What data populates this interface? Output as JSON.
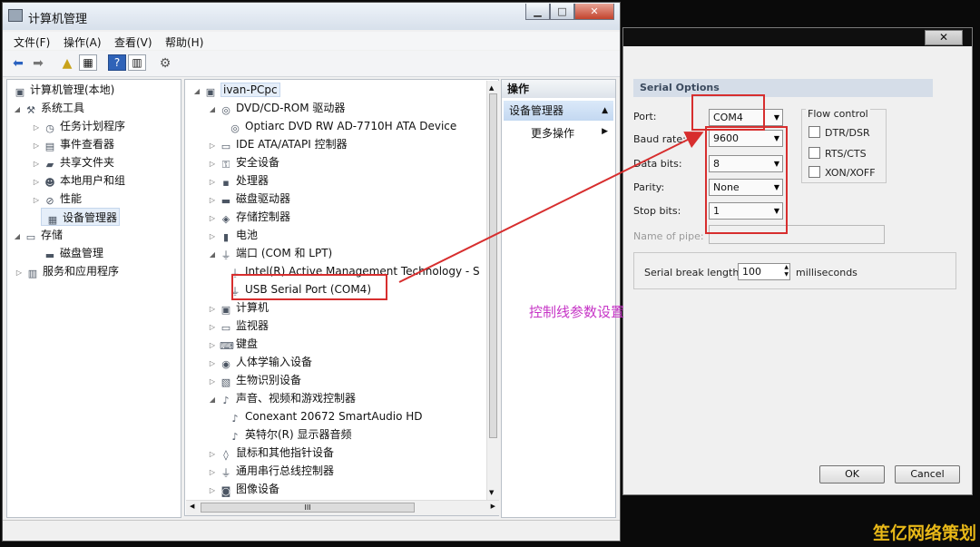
{
  "main_window": {
    "title": "计算机管理",
    "caption_buttons": {
      "minimize": "▁",
      "maximize": "□",
      "close": "✕"
    },
    "menu": [
      "文件(F)",
      "操作(A)",
      "查看(V)",
      "帮助(H)"
    ],
    "left_tree": [
      {
        "label": "计算机管理(本地)",
        "icon": "computer-manage-icon",
        "glyph": "▣"
      },
      {
        "label": "系统工具",
        "icon": "tools-icon",
        "glyph": "⚒"
      },
      {
        "label": "任务计划程序",
        "icon": "clock-icon",
        "glyph": "◷"
      },
      {
        "label": "事件查看器",
        "icon": "event-icon",
        "glyph": "▤"
      },
      {
        "label": "共享文件夹",
        "icon": "folder-icon",
        "glyph": "▰"
      },
      {
        "label": "本地用户和组",
        "icon": "users-icon",
        "glyph": "☻"
      },
      {
        "label": "性能",
        "icon": "performance-icon",
        "glyph": "⊘"
      },
      {
        "label": "设备管理器",
        "icon": "device-manager-icon",
        "glyph": "▦"
      },
      {
        "label": "存储",
        "icon": "storage-icon",
        "glyph": "▭"
      },
      {
        "label": "磁盘管理",
        "icon": "disk-icon",
        "glyph": "▬"
      },
      {
        "label": "服务和应用程序",
        "icon": "services-icon",
        "glyph": "▥"
      }
    ],
    "device_tree": [
      {
        "label": "ivan-PCpc",
        "icon": "computer-icon",
        "glyph": "▣"
      },
      {
        "label": "DVD/CD-ROM 驱动器",
        "icon": "dvd-icon",
        "glyph": "◎"
      },
      {
        "label": "Optiarc DVD RW AD-7710H ATA Device",
        "icon": "dvd-drive-icon",
        "glyph": "◎"
      },
      {
        "label": "IDE ATA/ATAPI 控制器",
        "icon": "ide-icon",
        "glyph": "▭"
      },
      {
        "label": "安全设备",
        "icon": "security-icon",
        "glyph": "⚿"
      },
      {
        "label": "处理器",
        "icon": "processor-icon",
        "glyph": "▪"
      },
      {
        "label": "磁盘驱动器",
        "icon": "disk-drive-icon",
        "glyph": "▬"
      },
      {
        "label": "存储控制器",
        "icon": "storage-controller-icon",
        "glyph": "◈"
      },
      {
        "label": "电池",
        "icon": "battery-icon",
        "glyph": "▮"
      },
      {
        "label": "端口 (COM 和 LPT)",
        "icon": "port-icon",
        "glyph": "⏚"
      },
      {
        "label": "Intel(R) Active Management Technology - S",
        "icon": "port-device-icon",
        "glyph": "⏚"
      },
      {
        "label": "USB Serial Port (COM4)",
        "icon": "usb-serial-icon",
        "glyph": "⏚"
      },
      {
        "label": "计算机",
        "icon": "pc-icon",
        "glyph": "▣"
      },
      {
        "label": "监视器",
        "icon": "monitor-icon",
        "glyph": "▭"
      },
      {
        "label": "键盘",
        "icon": "keyboard-icon",
        "glyph": "⌨"
      },
      {
        "label": "人体学输入设备",
        "icon": "hid-icon",
        "glyph": "◉"
      },
      {
        "label": "生物识别设备",
        "icon": "biometric-icon",
        "glyph": "▧"
      },
      {
        "label": "声音、视频和游戏控制器",
        "icon": "sound-icon",
        "glyph": "♪"
      },
      {
        "label": "Conexant 20672 SmartAudio HD",
        "icon": "audio-device-icon",
        "glyph": "♪"
      },
      {
        "label": "英特尔(R) 显示器音频",
        "icon": "display-audio-icon",
        "glyph": "♪"
      },
      {
        "label": "鼠标和其他指针设备",
        "icon": "mouse-icon",
        "glyph": "◊"
      },
      {
        "label": "通用串行总线控制器",
        "icon": "usb-icon",
        "glyph": "⏚"
      },
      {
        "label": "图像设备",
        "icon": "camera-icon",
        "glyph": "◙"
      }
    ],
    "actions": {
      "header": "操作",
      "section": "设备管理器",
      "more": "更多操作"
    },
    "hscroll_thumb_mark": "III"
  },
  "serial_dialog": {
    "close": "✕",
    "section_title": "Serial Options",
    "port": {
      "label": "Port:",
      "value": "COM4"
    },
    "baud_rate": {
      "label": "Baud rate:",
      "value": "9600"
    },
    "data_bits": {
      "label": "Data bits:",
      "value": "8"
    },
    "parity": {
      "label": "Parity:",
      "value": "None"
    },
    "stop_bits": {
      "label": "Stop bits:",
      "value": "1"
    },
    "pipe": {
      "label": "Name of pipe:",
      "value": ""
    },
    "flow_control": {
      "title": "Flow control",
      "options": [
        "DTR/DSR",
        "RTS/CTS",
        "XON/XOFF"
      ]
    },
    "break_length": {
      "label": "Serial break length:",
      "value": "100",
      "unit": "milliseconds"
    },
    "ok": "OK",
    "cancel": "Cancel"
  },
  "annotation": "控制线参数设置",
  "watermark": "笙亿网络策划",
  "colors": {
    "highlight": "#d72e2e",
    "annotation": "#c634c6",
    "watermark": "#e8b818"
  }
}
